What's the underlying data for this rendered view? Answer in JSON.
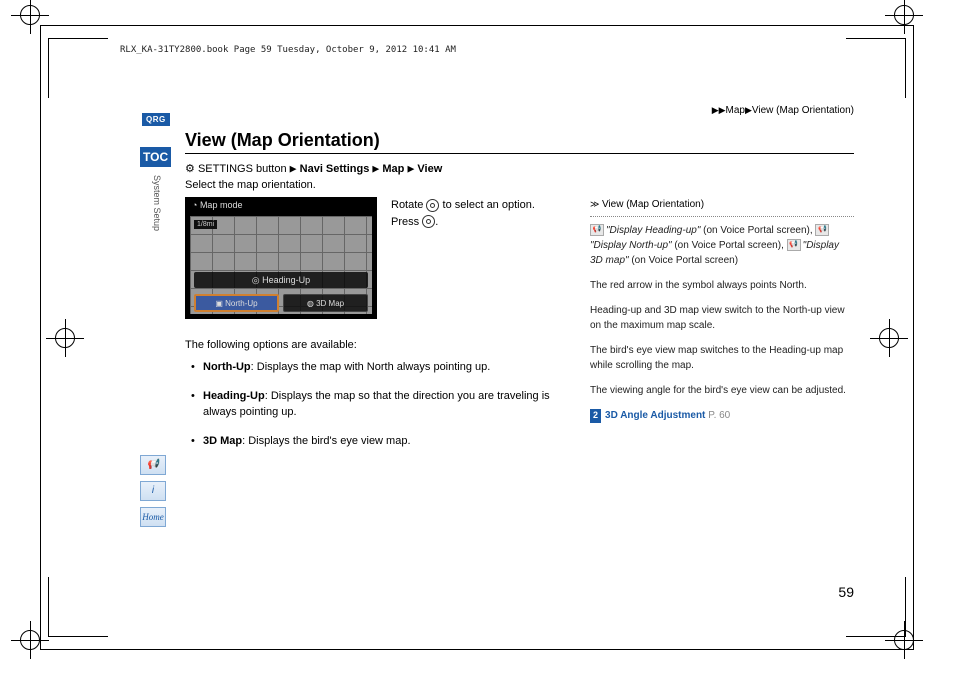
{
  "meta_header": "RLX_KA-31TY2800.book  Page 59  Tuesday, October 9, 2012  10:41 AM",
  "breadcrumb": {
    "a": "Map",
    "b": "View (Map Orientation)"
  },
  "badges": {
    "qrg": "QRG",
    "toc": "TOC"
  },
  "vertical_label": "System Setup",
  "side_icons": {
    "voice": "✦",
    "info": "i",
    "home": "Home"
  },
  "title": "View (Map Orientation)",
  "path": {
    "prefix": "SETTINGS button",
    "p1": "Navi Settings",
    "p2": "Map",
    "p3": "View"
  },
  "lead": "Select the map orientation.",
  "instruct": {
    "rotate": "Rotate",
    "rotate_after": "to select an option.",
    "press": "Press",
    "press_after": "."
  },
  "screenshot": {
    "title": "Map mode",
    "scale": "1/8mi",
    "heading": "Heading-Up",
    "opt1": "▣ North-Up",
    "opt2": "◍ 3D Map"
  },
  "following": "The following options are available:",
  "options": [
    {
      "name": "North-Up",
      "desc": ": Displays the map with North always pointing up."
    },
    {
      "name": "Heading-Up",
      "desc": ": Displays the map so that the direction you are traveling is always pointing up."
    },
    {
      "name": "3D Map",
      "desc": ": Displays the bird's eye view map."
    }
  ],
  "side": {
    "hdr": "View (Map Orientation)",
    "v1": "\"Display Heading-up\"",
    "v1_after": " (on Voice Portal screen), ",
    "v2": "\"Display North-up\"",
    "v2_after": " (on Voice Portal screen), ",
    "v3": "\"Display 3D map\"",
    "v3_after": " (on Voice Portal screen)",
    "p2": "The red arrow in the symbol always points North.",
    "p3": "Heading-up and 3D map view switch to the North-up view on the maximum map scale.",
    "p4": "The bird's eye view map switches to the Heading-up map while scrolling the map.",
    "p5": "The viewing angle for the bird's eye view can be adjusted.",
    "link_label": "3D Angle Adjustment",
    "link_page": "P. 60"
  },
  "page_number": "59"
}
